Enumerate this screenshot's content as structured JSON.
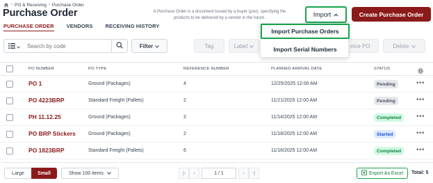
{
  "breadcrumb": {
    "items": [
      "PO & Receiving",
      "Purchase Order"
    ]
  },
  "page": {
    "title": "Purchase Order",
    "help_text": "A Purchase Order is a document issued by a buyer (you), specifying the products to be delivered by a vendor in the future."
  },
  "tabs": [
    {
      "label": "PURCHASE ORDER",
      "active": true
    },
    {
      "label": "VENDORS",
      "active": false
    },
    {
      "label": "RECEIVING HISTORY",
      "active": false
    }
  ],
  "actions": {
    "import_label": "Import",
    "create_label": "Create Purchase Order"
  },
  "import_menu": {
    "items": [
      "Import Purchase Orders",
      "Import Serial Numbers"
    ]
  },
  "toolbar": {
    "search_placeholder": "Search by code",
    "filter_label": "Filter",
    "tag_label": "Tag",
    "label_label": "Label",
    "receive_label": "eive PO",
    "delete_label": "Delete"
  },
  "table": {
    "headers": [
      "PO NUMBER",
      "PO TYPE",
      "REFERENCE NUMBER",
      "PLANNED ARRIVAL DATE",
      "STATUS"
    ],
    "rows": [
      {
        "po": "PO 1",
        "type": "Ground (Packages)",
        "ref": "4",
        "date": "12/25/2025 12:00 AM",
        "status": "Pending"
      },
      {
        "po": "PO 4223BRP",
        "type": "Standard Freight (Pallets)",
        "ref": "2",
        "date": "11/21/2025 12:00 AM",
        "status": "Pending"
      },
      {
        "po": "PH 11.12.25",
        "type": "Ground (Packages)",
        "ref": "2",
        "date": "11/14/2025 12:00 AM",
        "status": "Completed"
      },
      {
        "po": "PO BRP Stickers",
        "type": "Ground (Packages)",
        "ref": "2",
        "date": "11/18/2025 12:00 AM",
        "status": "Started"
      },
      {
        "po": "PO 1823BRP",
        "type": "Standard Freight (Pallets)",
        "ref": "6",
        "date": "11/16/2025 12:00 AM",
        "status": "Completed"
      }
    ]
  },
  "status_colors": {
    "Pending": {
      "bg": "#e5e7eb",
      "fg": "#4b5563"
    },
    "Completed": {
      "bg": "#d1fae5",
      "fg": "#15803d"
    },
    "Started": {
      "bg": "#dbeafe",
      "fg": "#1d4ed8"
    }
  },
  "footer": {
    "size_large": "Large",
    "size_small": "Small",
    "show_label": "Show 100 items",
    "page_indicator": "1 / 1",
    "export_label": "Export As Excel",
    "total_label": "Total: 5"
  },
  "colors": {
    "brand": "#8b1a1a",
    "highlight": "#16a34a"
  }
}
